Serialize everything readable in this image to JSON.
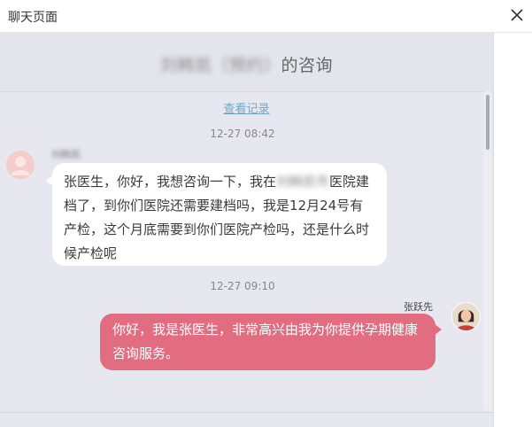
{
  "window": {
    "title": "聊天页面",
    "close_icon": "close-icon"
  },
  "chat": {
    "header": {
      "patient_name": "刘韩凯（预约）",
      "suffix": "的咨询"
    },
    "view_history": "查看记录",
    "messages": [
      {
        "time": "12-27 08:42",
        "sender": "刘韩凯",
        "direction": "incoming",
        "text_part1": "张医生，你好，我想咨询一下，我在",
        "redacted": "刘韩凯市",
        "text_part2": "医院建档了，到你们医院还需要建档吗，我是12月24号有产检，这个月底需要到你们医院产检吗，还是什么时候产检呢"
      },
      {
        "time": "12-27 09:10",
        "sender": "张跃先",
        "direction": "outgoing",
        "text": "你好，我是张医生，非常高兴由我为你提供孕期健康咨询服务。"
      }
    ]
  },
  "colors": {
    "outgoing_bubble": "#e36d80",
    "incoming_bubble": "#ffffff",
    "chat_background": "#e7e7ef",
    "link": "#6fa6c9"
  }
}
